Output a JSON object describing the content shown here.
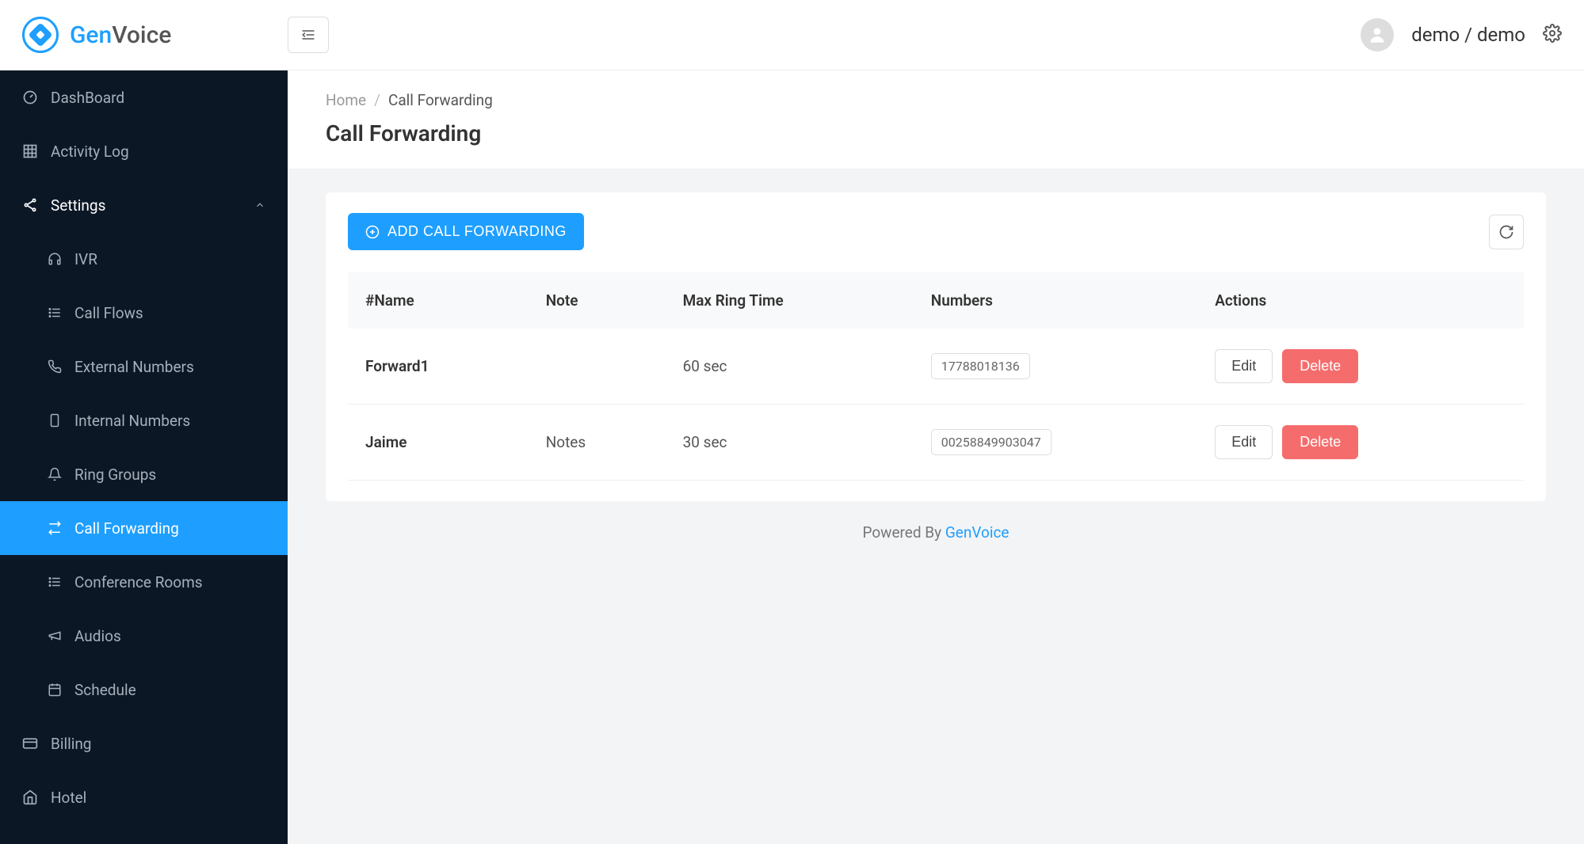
{
  "brand": {
    "prefix": "Gen",
    "suffix": "Voice"
  },
  "user": {
    "label": "demo / demo"
  },
  "sidebar": {
    "dashboard": "DashBoard",
    "activity_log": "Activity Log",
    "settings": "Settings",
    "sub": {
      "ivr": "IVR",
      "call_flows": "Call Flows",
      "external_numbers": "External Numbers",
      "internal_numbers": "Internal Numbers",
      "ring_groups": "Ring Groups",
      "call_forwarding": "Call Forwarding",
      "conference_rooms": "Conference Rooms",
      "audios": "Audios",
      "schedule": "Schedule"
    },
    "billing": "Billing",
    "hotel": "Hotel"
  },
  "breadcrumb": {
    "home": "Home",
    "current": "Call Forwarding"
  },
  "page_title": "Call Forwarding",
  "buttons": {
    "add": "ADD CALL FORWARDING",
    "edit": "Edit",
    "delete": "Delete"
  },
  "table": {
    "headers": {
      "name": "#Name",
      "note": "Note",
      "max_ring": "Max Ring Time",
      "numbers": "Numbers",
      "actions": "Actions"
    },
    "rows": [
      {
        "name": "Forward1",
        "note": "",
        "max_ring": "60 sec",
        "number": "17788018136"
      },
      {
        "name": "Jaime",
        "note": "Notes",
        "max_ring": "30 sec",
        "number": "00258849903047"
      }
    ]
  },
  "footer": {
    "text": "Powered By ",
    "link": "GenVoice"
  }
}
